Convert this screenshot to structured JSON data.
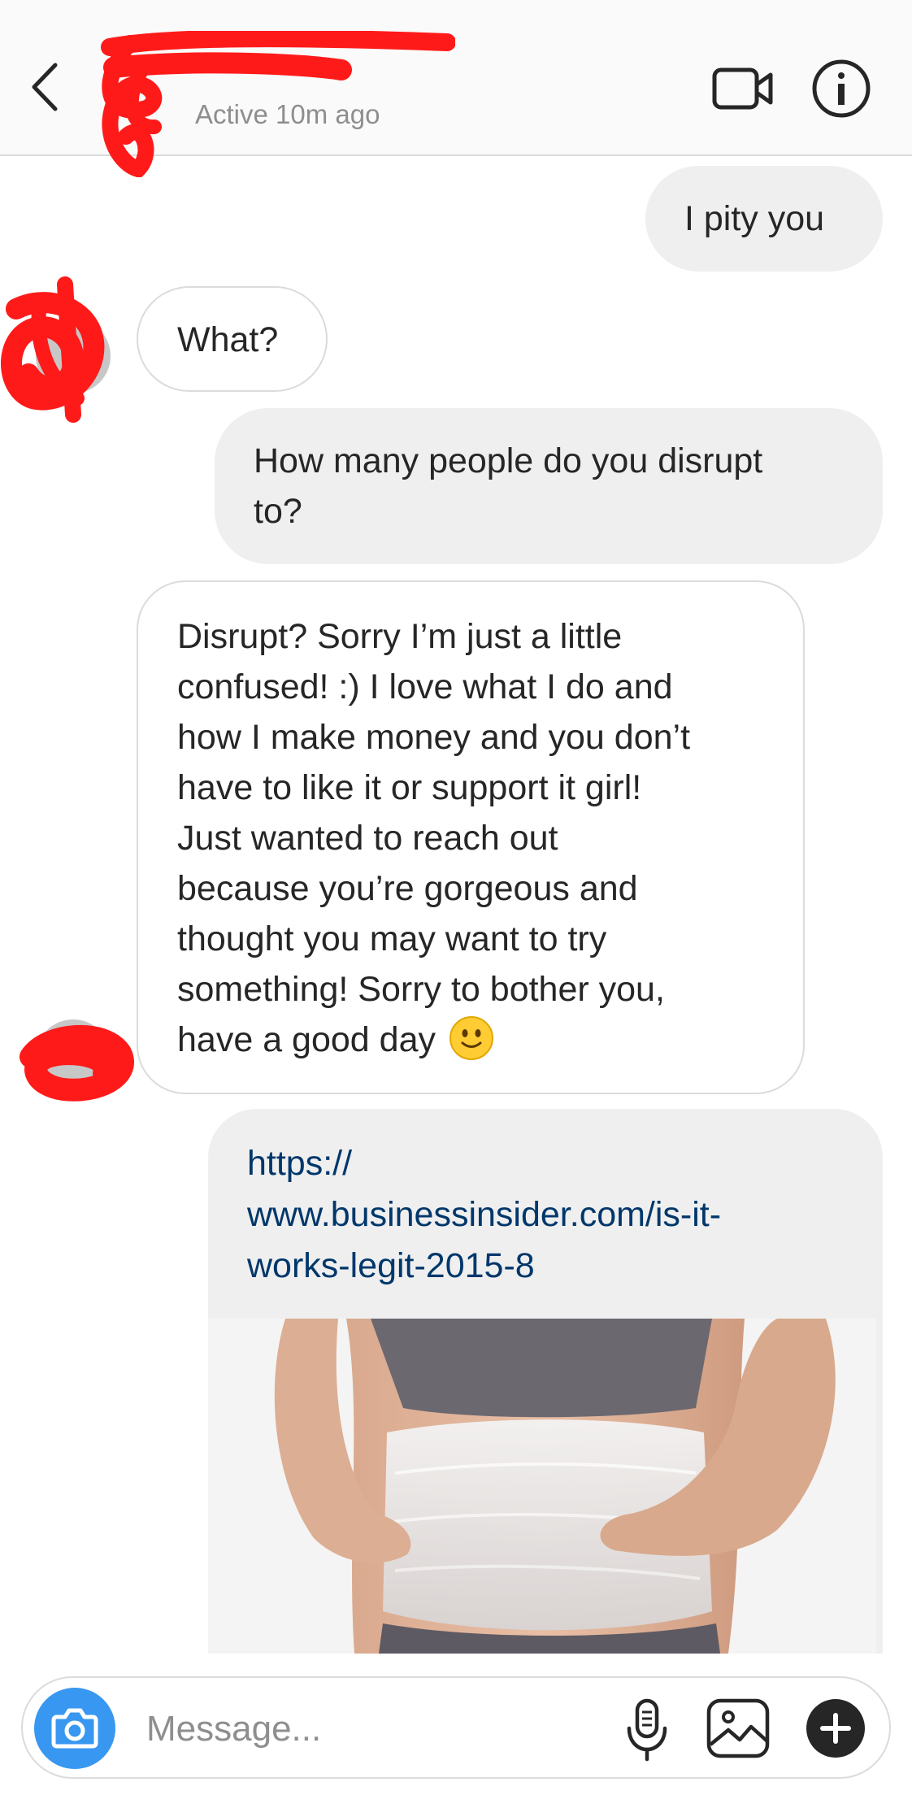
{
  "header": {
    "contact_name": "",
    "status": "Active 10m ago",
    "back_icon": "chevron-left-icon",
    "video_icon": "video-camera-icon",
    "info_icon": "info-icon"
  },
  "messages": [
    {
      "direction": "sent",
      "text": "I pity you"
    },
    {
      "direction": "received",
      "text": "What?"
    },
    {
      "direction": "sent",
      "text": "How many people do you disrupt\nto?"
    },
    {
      "direction": "received",
      "text": "Disrupt? Sorry I’m just a little\nconfused! :) I love what I do and\nhow I make money and you don’t\nhave to like it or support it girl!\nJust wanted to reach out\nbecause you’re gorgeous and\nthought you may want to try\nsomething! Sorry to bother you,\nhave a good day",
      "emoji": "slightly-smiling-face-icon"
    }
  ],
  "link_message": {
    "direction": "sent",
    "url_text": "https://\nwww.businessinsider.com/is-it-\nworks-legit-2015-8"
  },
  "composer": {
    "placeholder": "Message...",
    "camera_icon": "camera-icon",
    "mic_icon": "microphone-icon",
    "gallery_icon": "gallery-icon",
    "plus_icon": "plus-icon"
  },
  "colors": {
    "accent_blue": "#3897f0",
    "link_blue": "#00376b",
    "sent_bubble": "#efefef",
    "redaction_red": "#ff0000"
  }
}
